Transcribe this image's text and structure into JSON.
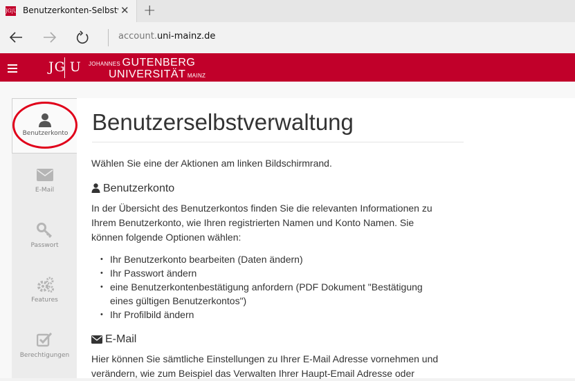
{
  "browser": {
    "tab_title": "Benutzerkonten-Selbstv",
    "tab_close": "✕",
    "new_tab": "+",
    "favicon_text": "JG|U",
    "url_prefix": "account.",
    "url_domain": "uni-mainz.de"
  },
  "header": {
    "logo_left": "JG",
    "logo_right": "U",
    "uni_line1_small": "JOHANNES ",
    "uni_line1_big": "GUTENBERG",
    "uni_line2_big": "UNIVERSITÄT",
    "uni_line2_small": " MAINZ",
    "accent_color": "#c1002a"
  },
  "sidebar": {
    "items": [
      {
        "label": "Benutzerkonto",
        "icon": "user-icon"
      },
      {
        "label": "E-Mail",
        "icon": "envelope-icon"
      },
      {
        "label": "Passwort",
        "icon": "key-icon"
      },
      {
        "label": "Features",
        "icon": "gears-icon"
      },
      {
        "label": "Berechtigungen",
        "icon": "checkbox-icon"
      }
    ]
  },
  "main": {
    "title": "Benutzerselbstverwaltung",
    "intro": "Wählen Sie eine der Aktionen am linken Bildschirmrand.",
    "section1_heading": "Benutzerkonto",
    "section1_line1": "In der Übersicht des Benutzerkontos finden Sie die relevanten Informationen zu",
    "section1_line2": "Ihrem Benutzerkonto, wie Ihren registrierten Namen und Konto Namen. Sie",
    "section1_line3": "können folgende Optionen wählen:",
    "options": [
      "Ihr Benutzerkonto bearbeiten (Daten ändern)",
      "Ihr Passwort ändern",
      "eine Benutzerkontenbestätigung anfordern (PDF Dokument \"Bestätigung",
      "eines gültigen Benutzerkontos\")",
      "Ihr Profilbild ändern"
    ],
    "section2_heading": "E-Mail",
    "section2_line1": "Hier können Sie sämtliche Einstellungen zu Ihrer E-Mail Adresse vornehmen und",
    "section2_line2": "verändern, wie zum Beispiel das Verwalten Ihrer Haupt-Email Adresse oder"
  }
}
